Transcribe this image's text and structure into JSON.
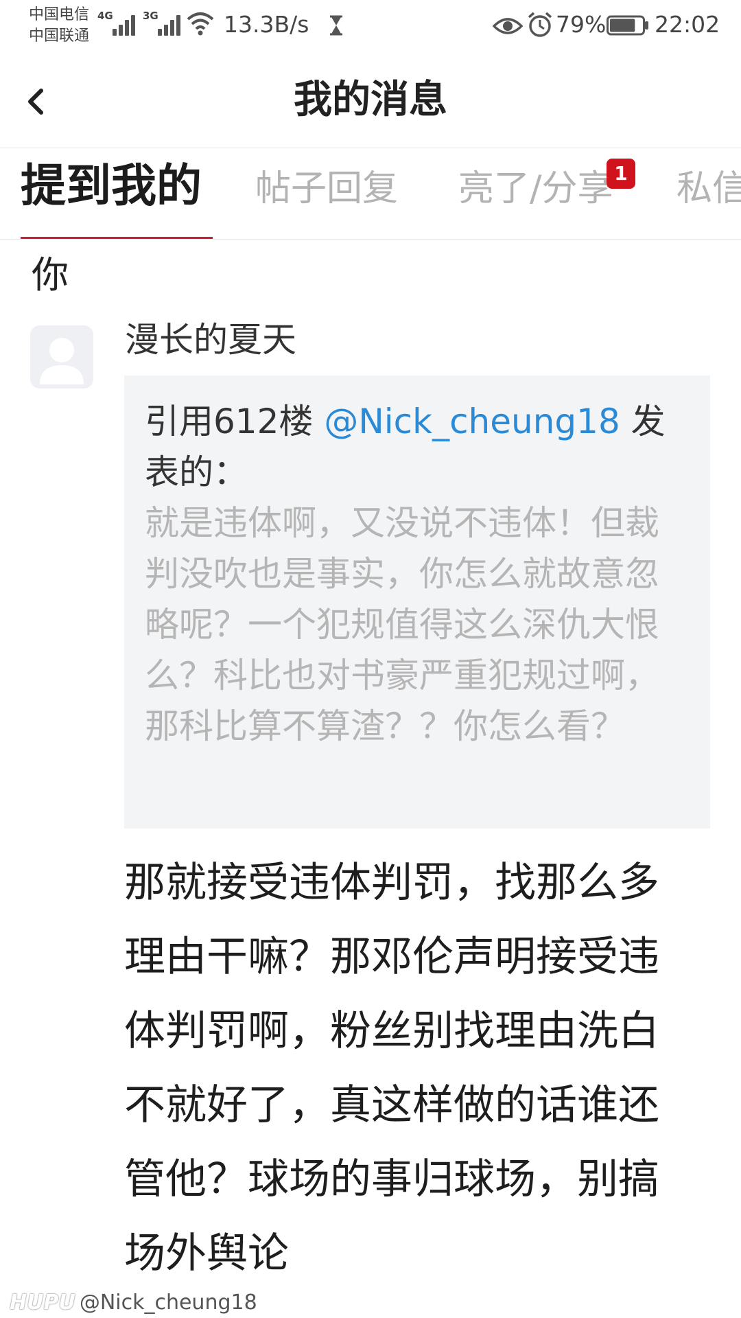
{
  "status_bar": {
    "carrier_1": "中国电信",
    "carrier_2": "中国联通",
    "net_1": "4G",
    "net_2": "3G",
    "net_speed": "13.3B/s",
    "battery_percent": "79%",
    "time": "22:02",
    "battery_level": 0.79
  },
  "header": {
    "back_icon": "chevron-left-icon",
    "title": "我的消息"
  },
  "tabs": {
    "items": [
      {
        "label": "提到我的",
        "active": true
      },
      {
        "label": "帖子回复",
        "active": false
      },
      {
        "label": "亮了/分享",
        "active": false,
        "badge": "1"
      },
      {
        "label": "私信",
        "active": false
      }
    ],
    "accent_color": "#c8202f",
    "badge_color": "#d0121d"
  },
  "content": {
    "previous_fragment": "你",
    "message": {
      "author": "漫长的夏天",
      "avatar_icon": "default-user-avatar-icon",
      "quote": {
        "prefix": "引用612楼 ",
        "mention": "@Nick_cheung18",
        "suffix": " 发表的：",
        "text": "就是违体啊，又没说不违体！但裁判没吹也是事实，你怎么就故意忽略呢？一个犯规值得这么深仇大恨么？科比也对书豪严重犯规过啊，那科比算不算渣？？你怎么看？"
      },
      "reply": "那就接受违体判罚，找那么多理由干嘛？那邓伦声明接受违体判罚啊，粉丝别找理由洗白不就好了，真这样做的话谁还管他？球场的事归球场，别搞场外舆论"
    },
    "mention_color": "#2a8ad6"
  },
  "watermark": {
    "logo": "HUPU",
    "handle": "@Nick_cheung18"
  }
}
